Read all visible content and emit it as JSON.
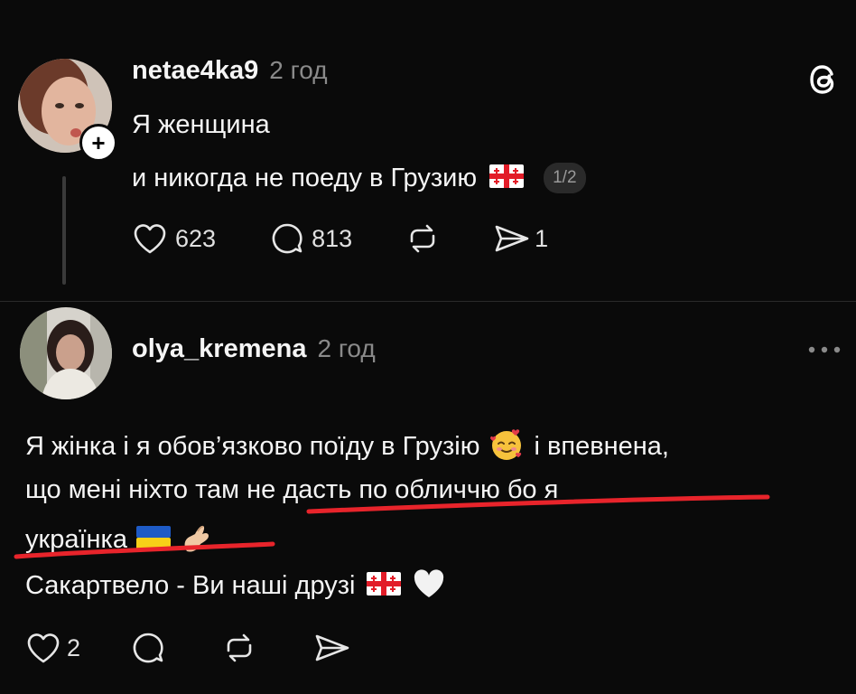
{
  "post": {
    "username": "netae4ka9",
    "time": "2 год",
    "lines": [
      "Я женщина",
      "и никогда не поеду в Грузию"
    ],
    "page_badge": "1/2",
    "likes": "623",
    "comments": "813",
    "shares": "1"
  },
  "reply": {
    "username": "olya_kremena",
    "time": "2 год",
    "lines": [
      "Я жінка і я обов’язково поїду в Грузію",
      "і впевнена,",
      "що мені ніхто там не дасть по обличчю бо я",
      "українка",
      "Сакартвело - Ви наші друзі"
    ],
    "likes": "2"
  },
  "colors": {
    "background": "#0a0a0a",
    "underline": "#e8242b",
    "muted": "#8a8a8a"
  }
}
